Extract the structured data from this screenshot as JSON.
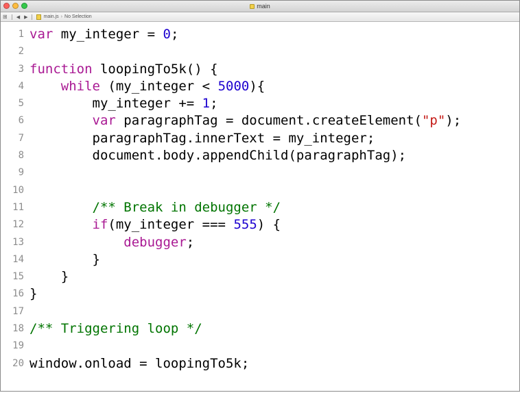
{
  "window": {
    "title": "main",
    "controls": [
      "close",
      "minimize",
      "zoom"
    ]
  },
  "jumpbar": {
    "grid_icon": "grid-icon",
    "back_icon": "back-arrow-icon",
    "forward_icon": "forward-arrow-icon",
    "file": "main.js",
    "selection": "No Selection"
  },
  "editor": {
    "lines": [
      {
        "num": "1",
        "tokens": [
          {
            "t": "var",
            "c": "kw"
          },
          {
            "t": " my_integer = ",
            "c": ""
          },
          {
            "t": "0",
            "c": "num"
          },
          {
            "t": ";",
            "c": ""
          }
        ]
      },
      {
        "num": "2",
        "tokens": []
      },
      {
        "num": "3",
        "tokens": [
          {
            "t": "function",
            "c": "kw"
          },
          {
            "t": " loopingTo5k() {",
            "c": ""
          }
        ]
      },
      {
        "num": "4",
        "tokens": [
          {
            "t": "    ",
            "c": ""
          },
          {
            "t": "while",
            "c": "kw"
          },
          {
            "t": " (my_integer < ",
            "c": ""
          },
          {
            "t": "5000",
            "c": "num"
          },
          {
            "t": "){",
            "c": ""
          }
        ]
      },
      {
        "num": "5",
        "tokens": [
          {
            "t": "        my_integer += ",
            "c": ""
          },
          {
            "t": "1",
            "c": "num"
          },
          {
            "t": ";",
            "c": ""
          }
        ]
      },
      {
        "num": "6",
        "tokens": [
          {
            "t": "        ",
            "c": ""
          },
          {
            "t": "var",
            "c": "kw"
          },
          {
            "t": " paragraphTag = document.createElement(",
            "c": ""
          },
          {
            "t": "\"p\"",
            "c": "str"
          },
          {
            "t": ");",
            "c": ""
          }
        ]
      },
      {
        "num": "7",
        "tokens": [
          {
            "t": "        paragraphTag.innerText = my_integer;",
            "c": ""
          }
        ]
      },
      {
        "num": "8",
        "tokens": [
          {
            "t": "        document.body.appendChild(paragraphTag);",
            "c": ""
          }
        ]
      },
      {
        "num": "9",
        "tokens": []
      },
      {
        "num": "10",
        "tokens": []
      },
      {
        "num": "11",
        "tokens": [
          {
            "t": "        ",
            "c": ""
          },
          {
            "t": "/** Break in debugger */",
            "c": "cmt"
          }
        ]
      },
      {
        "num": "12",
        "tokens": [
          {
            "t": "        ",
            "c": ""
          },
          {
            "t": "if",
            "c": "kw"
          },
          {
            "t": "(my_integer === ",
            "c": ""
          },
          {
            "t": "555",
            "c": "num"
          },
          {
            "t": ") {",
            "c": ""
          }
        ]
      },
      {
        "num": "13",
        "tokens": [
          {
            "t": "            ",
            "c": ""
          },
          {
            "t": "debugger",
            "c": "kw"
          },
          {
            "t": ";",
            "c": ""
          }
        ]
      },
      {
        "num": "14",
        "tokens": [
          {
            "t": "        }",
            "c": ""
          }
        ]
      },
      {
        "num": "15",
        "tokens": [
          {
            "t": "    }",
            "c": ""
          }
        ]
      },
      {
        "num": "16",
        "tokens": [
          {
            "t": "}",
            "c": ""
          }
        ]
      },
      {
        "num": "17",
        "tokens": []
      },
      {
        "num": "18",
        "tokens": [
          {
            "t": "/** Triggering loop */",
            "c": "cmt"
          }
        ]
      },
      {
        "num": "19",
        "tokens": []
      },
      {
        "num": "20",
        "tokens": [
          {
            "t": "window.onload = loopingTo5k;",
            "c": ""
          }
        ]
      }
    ]
  }
}
